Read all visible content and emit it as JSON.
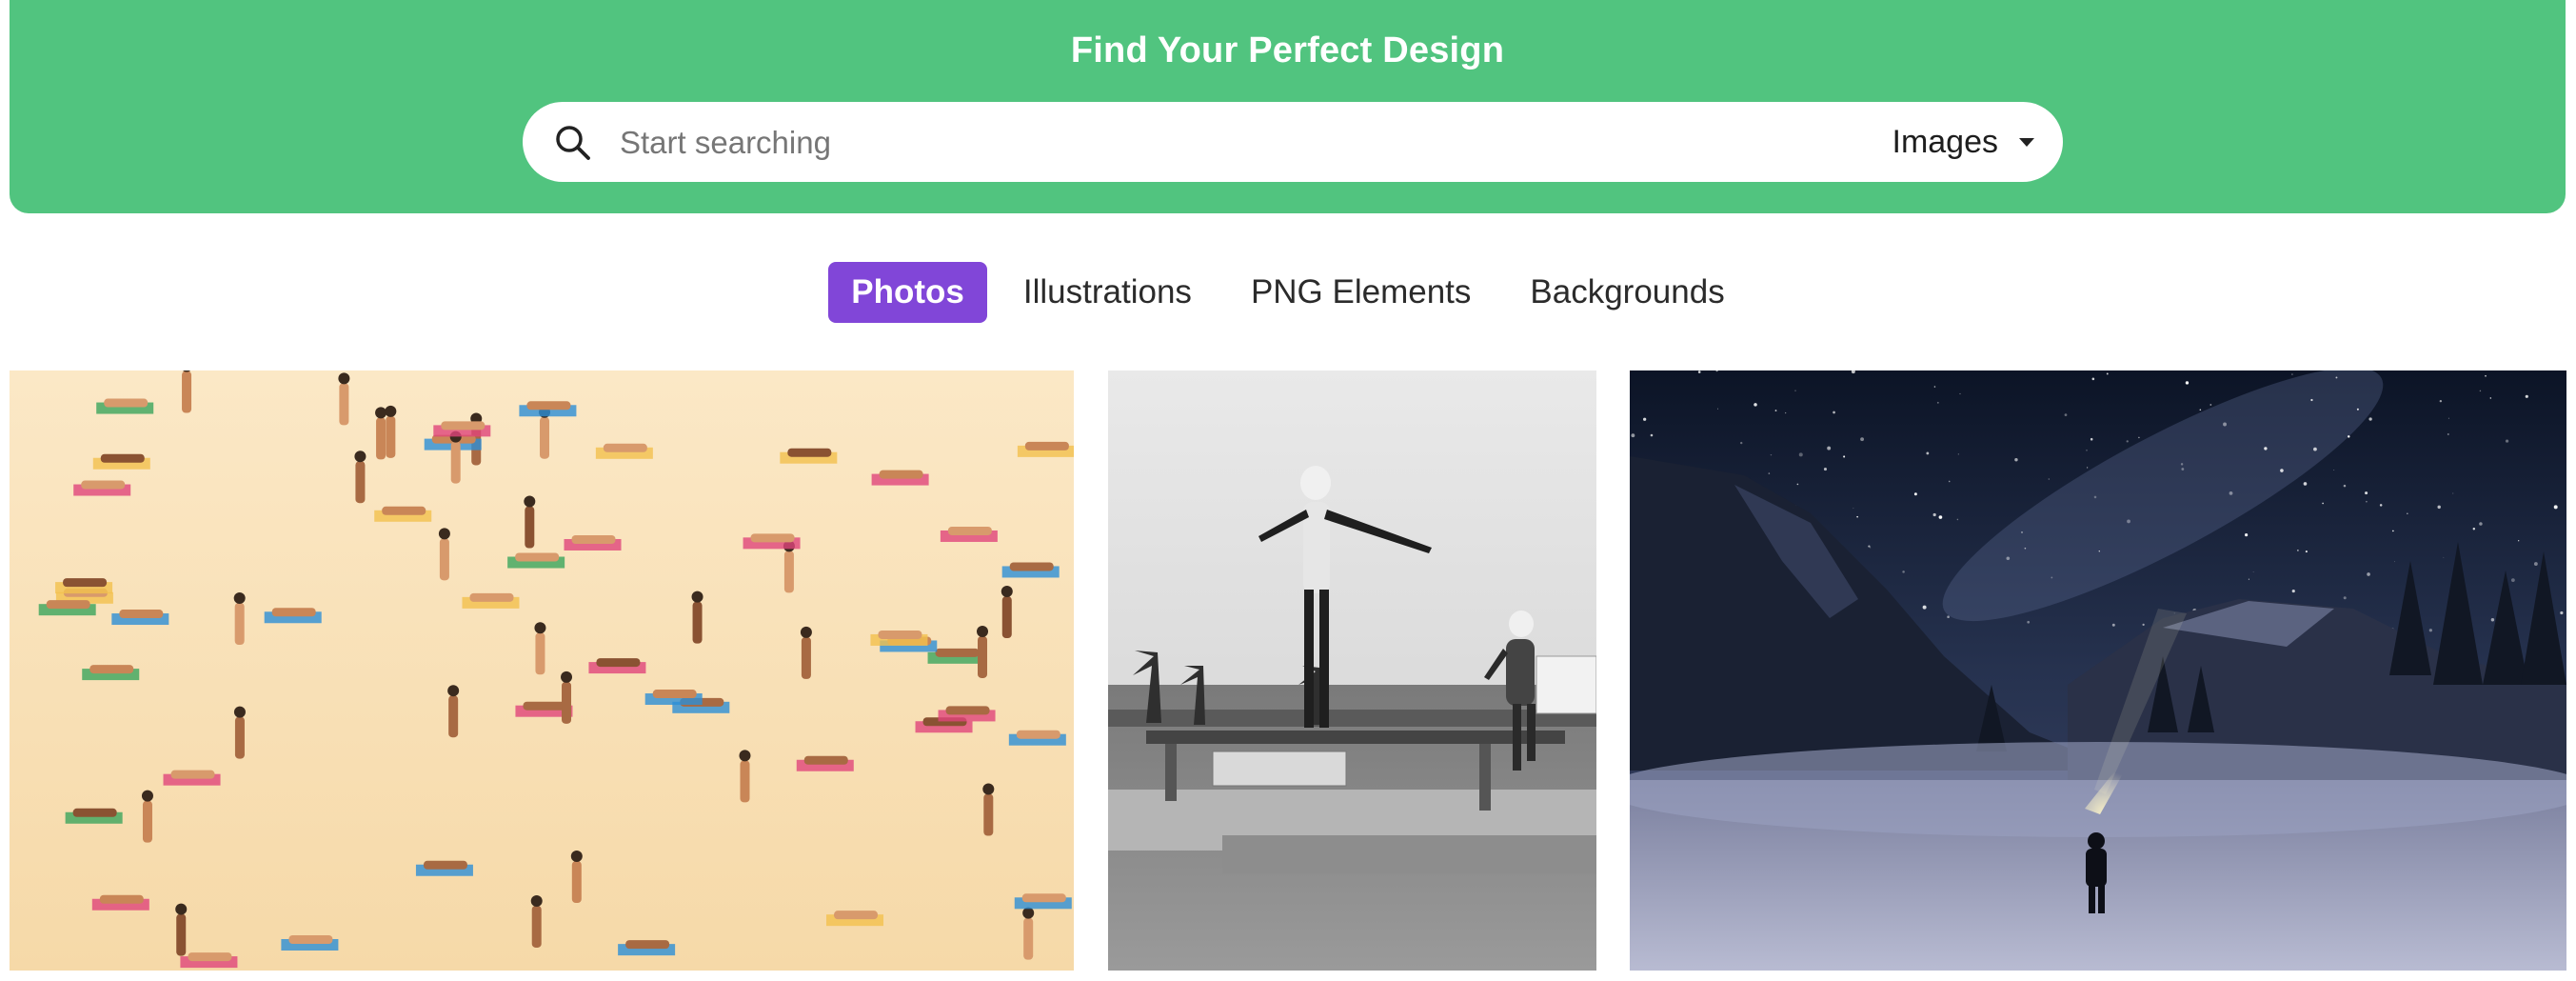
{
  "hero": {
    "title": "Find Your Perfect Design",
    "background_color": "#51c47f"
  },
  "search": {
    "placeholder": "Start searching",
    "value": "",
    "icon": "search-icon",
    "type_selected": "Images",
    "type_icon": "caret-down-icon"
  },
  "tabs": [
    {
      "label": "Photos",
      "active": true
    },
    {
      "label": "Illustrations",
      "active": false
    },
    {
      "label": "PNG Elements",
      "active": false
    },
    {
      "label": "Backgrounds",
      "active": false
    }
  ],
  "accent_color": "#8146d8",
  "gallery": [
    {
      "name": "beach-crowd-photo"
    },
    {
      "name": "vintage-diving-board-photo"
    },
    {
      "name": "night-valley-stars-photo"
    }
  ]
}
